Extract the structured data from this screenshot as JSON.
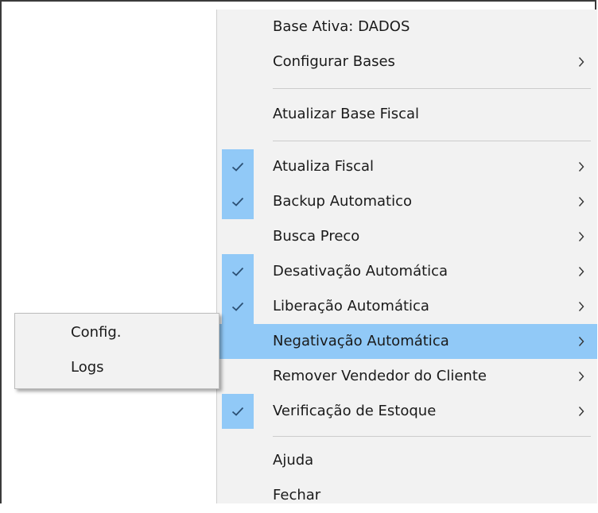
{
  "menu": {
    "items": [
      {
        "label": "Base Ativa: DADOS",
        "checked": false,
        "submenu": false
      },
      {
        "label": "Configurar Bases",
        "checked": false,
        "submenu": true
      },
      {
        "label": "Atualizar Base Fiscal",
        "checked": false,
        "submenu": false
      },
      {
        "label": "Atualiza Fiscal",
        "checked": true,
        "submenu": true
      },
      {
        "label": "Backup Automatico",
        "checked": true,
        "submenu": true
      },
      {
        "label": "Busca Preco",
        "checked": false,
        "submenu": true
      },
      {
        "label": "Desativação Automática",
        "checked": true,
        "submenu": true
      },
      {
        "label": "Liberação Automática",
        "checked": true,
        "submenu": true
      },
      {
        "label": "Negativação Automática",
        "checked": false,
        "submenu": true,
        "highlighted": true
      },
      {
        "label": "Remover Vendedor do Cliente",
        "checked": false,
        "submenu": true
      },
      {
        "label": "Verificação de Estoque",
        "checked": true,
        "submenu": true
      },
      {
        "label": "Ajuda",
        "checked": false,
        "submenu": false
      },
      {
        "label": "Fechar",
        "checked": false,
        "submenu": false
      }
    ]
  },
  "submenu": {
    "items": [
      {
        "label": "Config."
      },
      {
        "label": "Logs"
      }
    ]
  },
  "icons": {
    "check": "checkmark-icon",
    "arrow": "chevron-right-icon"
  },
  "colors": {
    "highlight": "#91c9f7",
    "menu_bg": "#f2f2f2",
    "text": "#1a1a1a"
  }
}
